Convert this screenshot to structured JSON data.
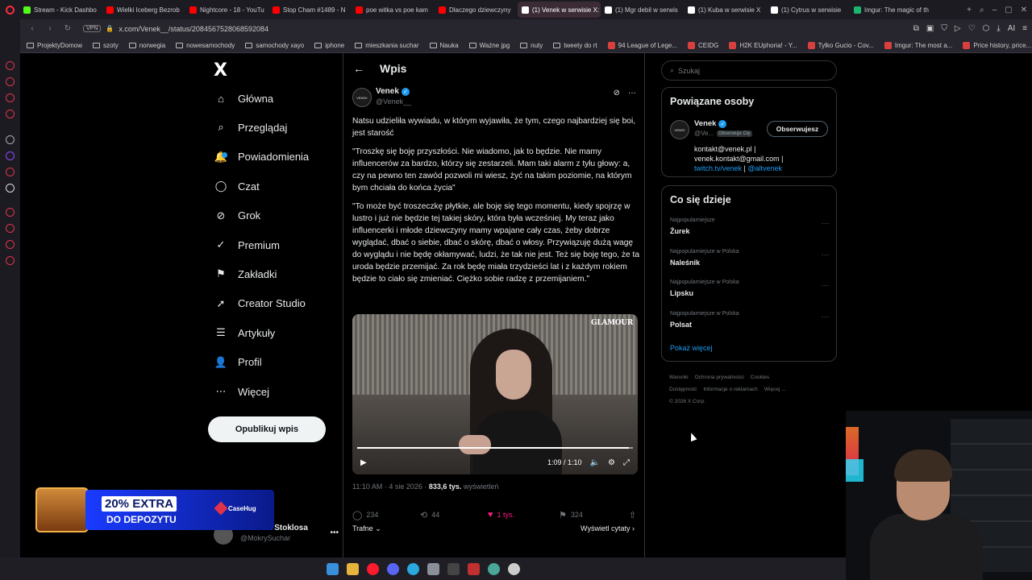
{
  "browser": {
    "tabs": [
      {
        "title": "Stream - Kick Dashbo",
        "color": "#53fc18",
        "active": false
      },
      {
        "title": "Wielki Iceberg Bezrob",
        "color": "#ff0000",
        "active": false
      },
      {
        "title": "Nightcore - 18 - YouTu",
        "color": "#ff0000",
        "active": false
      },
      {
        "title": "Stop Cham #1489 - N",
        "color": "#ff0000",
        "active": false
      },
      {
        "title": "poe witka vs poe kam",
        "color": "#ff0000",
        "active": false
      },
      {
        "title": "Dlaczego dziewczyny",
        "color": "#ff0000",
        "active": false
      },
      {
        "title": "(1) Venek w serwisie X: „N",
        "color": "#ffffff",
        "active": true
      },
      {
        "title": "(1) Mgr debil w serwis",
        "color": "#ffffff",
        "active": false
      },
      {
        "title": "(1) Kuba w serwisie X",
        "color": "#ffffff",
        "active": false
      },
      {
        "title": "(1) Cytrus w serwisie",
        "color": "#ffffff",
        "active": false
      },
      {
        "title": "Imgur: The magic of th",
        "color": "#1bb76e",
        "active": false
      }
    ],
    "url": "x.com/Venek__/status/2084567528068592084",
    "vpn_label": "VPN",
    "bookmarks": [
      {
        "label": "ProjektyDomow",
        "type": "folder"
      },
      {
        "label": "szoty",
        "type": "folder"
      },
      {
        "label": "norwegia",
        "type": "folder"
      },
      {
        "label": "nowesamochody",
        "type": "folder"
      },
      {
        "label": "samochody xayo",
        "type": "folder"
      },
      {
        "label": "iphone",
        "type": "folder"
      },
      {
        "label": "mieszkania suchar",
        "type": "folder"
      },
      {
        "label": "Nauka",
        "type": "folder"
      },
      {
        "label": "Ważne jpg",
        "type": "folder"
      },
      {
        "label": "nuty",
        "type": "folder"
      },
      {
        "label": "tweety do rt",
        "type": "folder"
      },
      {
        "label": "94 League of Lege...",
        "type": "site"
      },
      {
        "label": "CEIDG",
        "type": "site"
      },
      {
        "label": "H2K EUphoria! - Y...",
        "type": "site"
      },
      {
        "label": "Tylko Gucio - Cov...",
        "type": "site"
      },
      {
        "label": "Imgur: The most a...",
        "type": "site"
      },
      {
        "label": "Price history, price...",
        "type": "site"
      }
    ],
    "ai_label": "AI"
  },
  "sidebar": {
    "logo": "X",
    "items": [
      {
        "label": "Główna",
        "icon": "home-icon"
      },
      {
        "label": "Przeglądaj",
        "icon": "search-icon"
      },
      {
        "label": "Powiadomienia",
        "icon": "bell-icon"
      },
      {
        "label": "Czat",
        "icon": "chat-icon"
      },
      {
        "label": "Grok",
        "icon": "grok-icon"
      },
      {
        "label": "Premium",
        "icon": "premium-icon"
      },
      {
        "label": "Zakładki",
        "icon": "bookmark-icon"
      },
      {
        "label": "Creator Studio",
        "icon": "rocket-icon"
      },
      {
        "label": "Artykuły",
        "icon": "article-icon"
      },
      {
        "label": "Profil",
        "icon": "profile-icon"
      },
      {
        "label": "Więcej",
        "icon": "more-icon"
      }
    ],
    "post_button": "Opublikuj wpis",
    "account": {
      "name": "Dominik Stoklosa",
      "handle": "@MokrySuchar",
      "more": "•••"
    }
  },
  "main": {
    "title": "Wpis",
    "tweet": {
      "avatar_text": "VENEK",
      "name": "Venek",
      "handle": "@Venek__",
      "paragraphs": [
        "Natsu udzieliła wywiadu, w którym wyjawiła, że tym, czego najbardziej się boi, jest starość",
        "\"Troszkę się boję przyszłości. Nie wiadomo, jak to będzie. Nie mamy influencerów za bardzo, którzy się zestarzeli. Mam taki alarm z tyłu głowy: a, czy na pewno ten zawód pozwoli mi wiesz, żyć na takim poziomie, na którym bym chciała do końca życia\"",
        "\"To może być troszeczkę płytkie, ale boję się tego momentu, kiedy spojrzę w lustro i już nie będzie tej takiej skóry, która była wcześniej. My teraz jako influencerki i młode dziewczyny mamy wpajane cały czas, żeby dobrze wyglądać, dbać o siebie, dbać o skórę, dbać o włosy. Przywiązuję dużą wagę do wyglądu i nie będę okłamywać, ludzi, że tak nie jest. Też się boję tego, że ta uroda będzie przemijać. Za rok będę miała trzydzieści lat i z każdym rokiem będzie to ciało się zmieniać. Ciężko sobie radzę z przemijaniem.\""
      ],
      "video": {
        "watermark": "GLAMOUR",
        "time": "1:09 / 1:10",
        "progress": 0.986
      },
      "meta": {
        "time": "11:10 AM · 4 sie 2026 · ",
        "views": "833,6 tys.",
        "views_label": " wyświetleń"
      },
      "actions": {
        "replies": "234",
        "retweets": "44",
        "likes": "1 tys.",
        "bookmarks": "324"
      },
      "sort_label": "Trafne",
      "quotes_label": "Wyświetl cytaty"
    }
  },
  "right": {
    "search_placeholder": "Szukaj",
    "related": {
      "title": "Powiązane osoby",
      "name": "Venek",
      "handle": "@Ve...",
      "badge": "Obserwuje Cię",
      "follow_button": "Obserwujesz",
      "bio_line1": "kontakt@venek.pl |",
      "bio_line2": "venek.kontakt@gmail.com |",
      "bio_link1": "twitch.tv/venek",
      "bio_sep": " | ",
      "bio_link2": "@altvenek"
    },
    "trends": {
      "title": "Co się dzieje",
      "items": [
        {
          "label": "Najpopularniejsze",
          "value": "Żurek"
        },
        {
          "label": "Najpopularniejsze w Polska",
          "value": "Naleśnik"
        },
        {
          "label": "Najpopularniejsze w Polska",
          "value": "Lipsku"
        },
        {
          "label": "Najpopularniejsze w Polska",
          "value": "Polsat"
        }
      ],
      "show_more": "Pokaż więcej"
    },
    "footer": {
      "links": [
        "Warunki",
        "Ochrona prywatności",
        "Cookies",
        "Dostępność",
        "Informacje o reklamach",
        "Więcej ..."
      ],
      "copyright": "© 2026 X Corp."
    }
  },
  "promo": {
    "line1": "20% EXTRA",
    "line2": "DO DEPOZYTU",
    "brand": "CaseHug"
  }
}
